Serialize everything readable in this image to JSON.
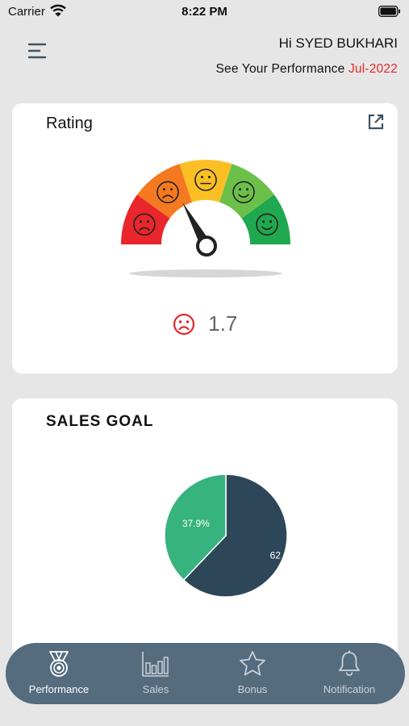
{
  "status_bar": {
    "carrier": "Carrier",
    "time": "8:22 PM"
  },
  "header": {
    "greeting": "Hi SYED BUKHARI",
    "performance_prefix": "See Your Performance ",
    "month": "Jul-2022"
  },
  "rating_card": {
    "title": "Rating",
    "value": "1.7",
    "scale_max": 5,
    "segment_colors": [
      "#e8262b",
      "#f47920",
      "#fbbf24",
      "#6cc04a",
      "#1fa84f"
    ]
  },
  "sales_card": {
    "title": "SALES GOAL",
    "chart_data": {
      "type": "pie",
      "slices": [
        {
          "value": 62.1,
          "label": "62",
          "color": "#2d4758"
        },
        {
          "value": 37.9,
          "label": "37.9%",
          "color": "#36b37e"
        }
      ]
    }
  },
  "tabbar": {
    "tabs": [
      {
        "label": "Performance",
        "icon": "medal-icon",
        "active": true
      },
      {
        "label": "Sales",
        "icon": "bar-chart-icon",
        "active": false
      },
      {
        "label": "Bonus",
        "icon": "star-icon",
        "active": false
      },
      {
        "label": "Notification",
        "icon": "bell-icon",
        "active": false
      }
    ]
  }
}
